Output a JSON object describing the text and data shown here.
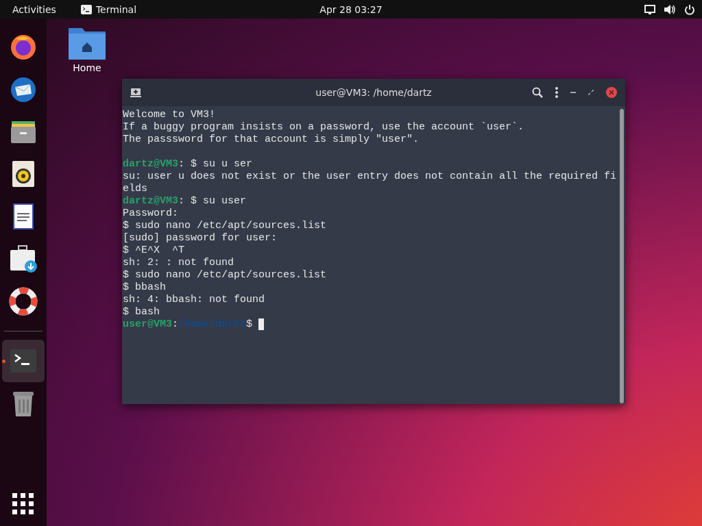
{
  "top_bar": {
    "activities": "Activities",
    "app_name": "Terminal",
    "clock": "Apr 28  03:27"
  },
  "dock": {
    "items": [
      {
        "kind": "browser",
        "running": false
      },
      {
        "kind": "mail",
        "running": false
      },
      {
        "kind": "files",
        "running": false
      },
      {
        "kind": "music",
        "running": false
      },
      {
        "kind": "writer",
        "running": false
      },
      {
        "kind": "software",
        "running": false
      },
      {
        "kind": "help",
        "running": false
      },
      {
        "kind": "separator"
      },
      {
        "kind": "terminal",
        "running": true
      },
      {
        "kind": "trash",
        "running": false
      }
    ]
  },
  "desktop_icons": [
    {
      "label": "Home"
    }
  ],
  "window": {
    "title": "user@VM3: /home/dartz",
    "lines": [
      {
        "parts": [
          {
            "kind": "plain",
            "text": "Welcome to VM3!"
          }
        ]
      },
      {
        "parts": [
          {
            "kind": "plain",
            "text": "If a buggy program insists on a password, use the account `user`."
          }
        ]
      },
      {
        "parts": [
          {
            "kind": "plain",
            "text": "The passsword for that account is simply \"user\"."
          }
        ]
      },
      {
        "kind": "blank"
      },
      {
        "parts": [
          {
            "kind": "host",
            "text": "dartz@VM3"
          },
          {
            "kind": "plain",
            "text": ": $ su u ser"
          }
        ]
      },
      {
        "parts": [
          {
            "kind": "plain",
            "text": "su: user u does not exist or the user entry does not contain all the required fi"
          }
        ]
      },
      {
        "parts": [
          {
            "kind": "plain",
            "text": "elds"
          }
        ]
      },
      {
        "parts": [
          {
            "kind": "host",
            "text": "dartz@VM3"
          },
          {
            "kind": "plain",
            "text": ": $ su user"
          }
        ]
      },
      {
        "parts": [
          {
            "kind": "plain",
            "text": "Password:"
          }
        ]
      },
      {
        "parts": [
          {
            "kind": "plain",
            "text": "$ sudo nano /etc/apt/sources.list"
          }
        ]
      },
      {
        "parts": [
          {
            "kind": "plain",
            "text": "[sudo] password for user:"
          }
        ]
      },
      {
        "parts": [
          {
            "kind": "plain",
            "text": "$ ^E^X  ^T"
          }
        ]
      },
      {
        "parts": [
          {
            "kind": "plain",
            "text": "sh: 2: : not found"
          }
        ]
      },
      {
        "parts": [
          {
            "kind": "plain",
            "text": "$ sudo nano /etc/apt/sources.list"
          }
        ]
      },
      {
        "parts": [
          {
            "kind": "plain",
            "text": "$ bbash"
          }
        ]
      },
      {
        "parts": [
          {
            "kind": "plain",
            "text": "sh: 4: bbash: not found"
          }
        ]
      },
      {
        "parts": [
          {
            "kind": "plain",
            "text": "$ bash"
          }
        ]
      },
      {
        "parts": [
          {
            "kind": "host",
            "text": "user@VM3"
          },
          {
            "kind": "plain",
            "text": ":"
          },
          {
            "kind": "path",
            "text": "/home/dartz"
          },
          {
            "kind": "plain",
            "text": "$ "
          }
        ],
        "cursor": true
      }
    ]
  }
}
